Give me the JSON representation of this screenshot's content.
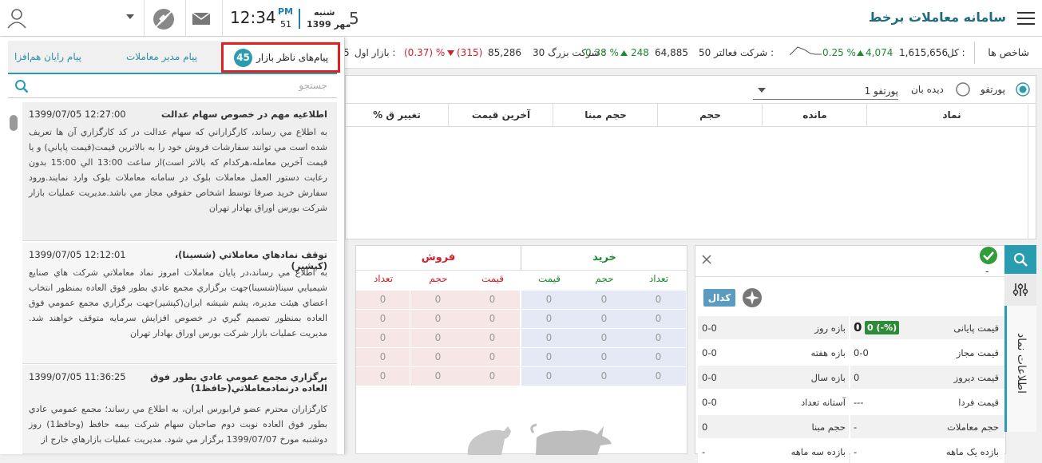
{
  "header": {
    "app_title": "سامانه معاملات برخط",
    "day_num": "5",
    "weekday": "شنبه",
    "month_year_a": "مهر",
    "month_year_b": "1399",
    "ampm": "PM",
    "seconds": "51",
    "time": "12:34"
  },
  "ticker": {
    "index_label": "شاخص ها",
    "total_label": "کل :",
    "total_value": "1,615,656",
    "total_change": "4,074",
    "total_pct": "0.25 %",
    "equal_text": "50 شرکت فعالتر :",
    "equal_value": "64,885",
    "equal_change": "248",
    "equal_pct": "0.38 %",
    "big_text": "30 شرکت بزرگ :",
    "big_value": "85,286",
    "big_change": "(315)",
    "big_pct": "(0.37) %",
    "market_label": "بازار اول :",
    "market_clip": "5"
  },
  "portfolio": {
    "radio1": "پورتفو",
    "radio2": "دیده بان",
    "select_value": "پورتفو 1",
    "columns": [
      "نماد",
      "مانده",
      "حجم",
      "حجم مبنا",
      "آخرین قیمت",
      "% تغییر ق"
    ]
  },
  "messages": {
    "tabs": [
      {
        "label": "پیام‌های ناظر بازار",
        "badge": "45"
      },
      {
        "label": "پیام مدیر معاملات"
      },
      {
        "label": "پیام رایان هم‌افزا"
      }
    ],
    "search_placeholder": "جستجو",
    "items": [
      {
        "title": "اطلاعيه مهم در خصوص سهام عدالت",
        "date": "1399/07/05 12:27:00",
        "body": "به اطلاع مي رساند، کارگزاراني که سهام عدالت در کد کارگزاري آن ها تعريف شده است مي توانند سفارشات فروش خود را به بالاترين قيمت(قيمت پاياني) و يا قيمت آخرين معامله،هرکدام که بالاتر است)از ساعت 13:00 الي 15:00 بدون رعايت دستور العمل معاملات بلوک در سامانه معاملات بلوک وارد نمايند.ورود سفارش خريد صرفا توسط اشخاص حقوقي مجاز مي باشد.مديريت عمليات بازار شرکت بورس اوراق بهادار تهران"
      },
      {
        "title": "توقف نمادهاي معاملاتي (شسينا)،(کپشير)",
        "date": "1399/07/05 12:12:01",
        "body": "به اطلاع مي رساند،در پايان معاملات امروز نماد معاملاتي شرکت هاي صنايع شيميايي سينا(شسينا)جهت برگزاري مجمع عادي بطور فوق العاده بمنظور انتخاب اعضاي هيئت مديره، پشم شيشه ايران(کپشير)جهت برگزاري مجمع عمومي فوق العاده بمنظور تصميم گيري در خصوص افزايش سرمايه متوقف خواهند شد. مديريت عمليات بازار شرکت بورس اوراق بهادار تهران"
      },
      {
        "title": "برگزاري مجمع عمومي عادي بطور فوق العاده درنمادمعاملاتي(حافظ1)",
        "date": "1399/07/05 11:36:25",
        "body": "کارگزاران محترم عضو فرابورس ايران، به اطلاع مي رساند؛ مجمع عمومي عادي بطور فوق العاده نوبت دوم صاحبان سهام شرکت بيمه حافظ (وحافظ1) روز دوشنبه مورخ 1399/07/07 برگزار مي شود. مديريت عمليات بازارهاي خارج از"
      }
    ]
  },
  "orderbook": {
    "buy_title": "خرید",
    "sell_title": "فروش",
    "buy_cols": [
      "تعداد",
      "حجم",
      "قیمت"
    ],
    "sell_cols": [
      "قیمت",
      "حجم",
      "تعداد"
    ],
    "zero": "0"
  },
  "symbol": {
    "side_label": "اطلاعات نماد",
    "dash": "-",
    "codal": "کدال",
    "rows": [
      {
        "l_label": "قیمت پایانی",
        "l_val": "0",
        "l_badge": "0 (-%)",
        "r_label": "بازه روز",
        "r_val": "0-0"
      },
      {
        "l_label": "قیمت مجاز",
        "l_val": "0-0",
        "r_label": "بازه هفته",
        "r_val": "0-0"
      },
      {
        "l_label": "قیمت دیروز",
        "l_val": "0",
        "r_label": "بازه سال",
        "r_val": "0-0"
      },
      {
        "l_label": "قیمت فردا",
        "l_val": "---",
        "r_label": "آستانه تعداد",
        "r_val": "0-0"
      },
      {
        "l_label": "حجم معاملات",
        "l_val": "-",
        "r_label": "حجم مبنا",
        "r_val": "0"
      },
      {
        "l_label": "بازده یک ماهه",
        "l_val": "-",
        "r_label": "بازده سه ماهه",
        "r_val": "-"
      }
    ]
  },
  "colors": {
    "accent": "#2a9cb0",
    "highlight": "#e02020",
    "buy": "#1c8a2e",
    "sell": "#d0202a"
  }
}
